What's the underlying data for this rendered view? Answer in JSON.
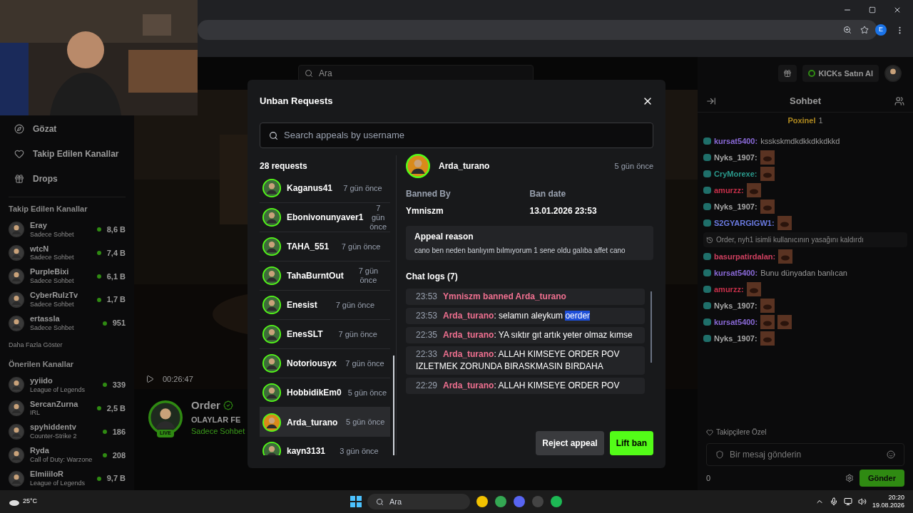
{
  "browser": {
    "profile": "E"
  },
  "sidebar": {
    "nav": [
      {
        "label": "Gözat"
      },
      {
        "label": "Takip Edilen Kanallar"
      },
      {
        "label": "Drops"
      }
    ],
    "followed_title": "Takip Edilen Kanallar",
    "followed": [
      {
        "name": "Eray",
        "category": "Sadece Sohbet",
        "viewers": "8,6 B"
      },
      {
        "name": "wtcN",
        "category": "Sadece Sohbet",
        "viewers": "7,4 B"
      },
      {
        "name": "PurpleBixi",
        "category": "Sadece Sohbet",
        "viewers": "6,1 B"
      },
      {
        "name": "CyberRulzTv",
        "category": "Sadece Sohbet",
        "viewers": "1,7 B"
      },
      {
        "name": "ertassla",
        "category": "Sadece Sohbet",
        "viewers": "951"
      }
    ],
    "show_more": "Daha Fazla Göster",
    "suggested_title": "Önerilen Kanallar",
    "suggested": [
      {
        "name": "yyiido",
        "category": "League of Legends",
        "viewers": "339"
      },
      {
        "name": "SercanZurna",
        "category": "IRL",
        "viewers": "2,5 B"
      },
      {
        "name": "spyhiddentv",
        "category": "Counter-Strike 2",
        "viewers": "186"
      },
      {
        "name": "Ryda",
        "category": "Call of Duty: Warzone",
        "viewers": "208"
      },
      {
        "name": "ElmiiiloR",
        "category": "League of Legends",
        "viewers": "9,7 B"
      }
    ]
  },
  "header": {
    "search_placeholder": "Ara",
    "buy_button": "KICKs Satın Al"
  },
  "stream": {
    "time": "00:26:47",
    "channel": "Order",
    "live": "LIVE",
    "title": "OLAYLAR FE",
    "category": "Sadece Sohbet"
  },
  "chat": {
    "title": "Sohbet",
    "pinned_user": "Poxinel",
    "pinned_count": "1",
    "messages": [
      {
        "kind": "text",
        "user": "kursat5400:",
        "color": "#8a6ad8",
        "text": "ksskskmdkdkkdkkdkkd"
      },
      {
        "kind": "emote",
        "user": "Nyks_1907:",
        "color": "#a8a8a8"
      },
      {
        "kind": "emote",
        "user": "CryMorexe:",
        "color": "#2a9a8c"
      },
      {
        "kind": "emote",
        "user": "amurzz:",
        "color": "#c8304a"
      },
      {
        "kind": "emote",
        "user": "Nyks_1907:",
        "color": "#a8a8a8"
      },
      {
        "kind": "emote",
        "user": "S2GYARGIGW1:",
        "color": "#6a7ae0"
      },
      {
        "kind": "system",
        "text": "Order, nyh1 isimli kullanıcının yasağını kaldırdı"
      },
      {
        "kind": "emote",
        "user": "basurpatirdalan:",
        "color": "#d04060"
      },
      {
        "kind": "text",
        "user": "kursat5400:",
        "color": "#8a6ad8",
        "text": "Bunu dünyadan banlıcan"
      },
      {
        "kind": "emote",
        "user": "amurzz:",
        "color": "#c8304a"
      },
      {
        "kind": "emote",
        "user": "Nyks_1907:",
        "color": "#a8a8a8"
      },
      {
        "kind": "emotes",
        "user": "kursat5400:",
        "color": "#8a6ad8"
      },
      {
        "kind": "emote",
        "user": "Nyks_1907:",
        "color": "#a8a8a8"
      }
    ],
    "followers_only": "Takipçilere Özel",
    "input_placeholder": "Bir mesaj gönderin",
    "points": "0",
    "send": "Gönder"
  },
  "modal": {
    "title": "Unban Requests",
    "search_placeholder": "Search appeals by username",
    "count": "28 requests",
    "requests": [
      {
        "user": "Kaganus41",
        "time": "7 gün önce",
        "selected": false
      },
      {
        "user": "Ebonivonunyaver1",
        "time": "7 gün önce",
        "selected": false
      },
      {
        "user": "TAHA_551",
        "time": "7 gün önce",
        "selected": false
      },
      {
        "user": "TahaBurntOut",
        "time": "7 gün önce",
        "selected": false
      },
      {
        "user": "Enesist",
        "time": "7 gün önce",
        "selected": false
      },
      {
        "user": "EnesSLT",
        "time": "7 gün önce",
        "selected": false
      },
      {
        "user": "Notoriousyx",
        "time": "7 gün önce",
        "selected": false
      },
      {
        "user": "HobbidikEm0",
        "time": "5 gün önce",
        "selected": false
      },
      {
        "user": "Arda_turano",
        "time": "5 gün önce",
        "selected": true
      },
      {
        "user": "kayn3131",
        "time": "3 gün önce",
        "selected": false
      }
    ],
    "detail": {
      "user": "Arda_turano",
      "time": "5 gün önce",
      "banned_by_label": "Banned By",
      "banned_by": "Ymniszm",
      "ban_date_label": "Ban date",
      "ban_date": "13.01.2026 23:53",
      "reason_title": "Appeal reason",
      "reason": "cano ben neden banlıyım bılmıyorum 1 sene oldu galıba affet cano",
      "logs_title": "Chat logs (7)",
      "logs": [
        {
          "kind": "ban",
          "time": "23:53",
          "text": "Ymniszm banned Arda_turano"
        },
        {
          "kind": "message",
          "time": "23:53",
          "user": "Arda_turano",
          "text": ": selamın aleykum",
          "highlighted": "oerder"
        },
        {
          "kind": "message",
          "time": "22:35",
          "user": "Arda_turano",
          "text": ": YA sıktır gıt artık yeter olmaz kımse"
        },
        {
          "kind": "message",
          "time": "22:33",
          "user": "Arda_turano",
          "text": ": ALLAH KIMSEYE ORDER POV IZLETMEK ZORUNDA BIRASKMASIN BIRDAHA"
        },
        {
          "kind": "message",
          "time": "22:29",
          "user": "Arda_turano",
          "text": ": ALLAH KIMSEYE ORDER POV"
        }
      ]
    },
    "buttons": {
      "reject": "Reject appeal",
      "lift": "Lift ban"
    }
  },
  "taskbar": {
    "temperature": "25°C",
    "search": "Ara",
    "time": "20:20",
    "date": "19.08.2026"
  }
}
